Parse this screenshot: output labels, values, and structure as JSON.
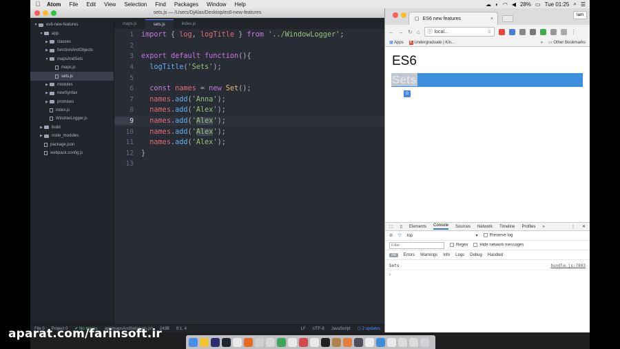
{
  "menubar": {
    "app": "Atom",
    "items": [
      "File",
      "Edit",
      "View",
      "Selection",
      "Find",
      "Packages",
      "Window",
      "Help"
    ],
    "battery": "28%",
    "clock": "Tue 01:25"
  },
  "atom": {
    "window_title": "sets.js — /Users/DjAlas/Desktop/es6-new-features",
    "tree": [
      {
        "label": "es6-new-features",
        "depth": 0,
        "type": "folder",
        "open": true
      },
      {
        "label": "app",
        "depth": 1,
        "type": "folder",
        "open": true
      },
      {
        "label": "classes",
        "depth": 2,
        "type": "folder",
        "open": false
      },
      {
        "label": "functionAndObjects",
        "depth": 2,
        "type": "folder",
        "open": false
      },
      {
        "label": "mapsAndSets",
        "depth": 2,
        "type": "folder",
        "open": true
      },
      {
        "label": "maps.js",
        "depth": 3,
        "type": "file"
      },
      {
        "label": "sets.js",
        "depth": 3,
        "type": "file",
        "selected": true
      },
      {
        "label": "modules",
        "depth": 2,
        "type": "folder",
        "open": false
      },
      {
        "label": "newSyntax",
        "depth": 2,
        "type": "folder",
        "open": false
      },
      {
        "label": "promises",
        "depth": 2,
        "type": "folder",
        "open": false
      },
      {
        "label": "index.js",
        "depth": 2,
        "type": "file"
      },
      {
        "label": "WindowLogger.js",
        "depth": 2,
        "type": "file"
      },
      {
        "label": "build",
        "depth": 1,
        "type": "folder",
        "open": false
      },
      {
        "label": "node_modules",
        "depth": 1,
        "type": "folder",
        "open": false
      },
      {
        "label": "package.json",
        "depth": 1,
        "type": "file"
      },
      {
        "label": "webpack.config.js",
        "depth": 1,
        "type": "file"
      }
    ],
    "tabs": [
      {
        "label": "maps.js",
        "active": false
      },
      {
        "label": "sets.js",
        "active": true
      },
      {
        "label": "index.js",
        "active": false
      }
    ],
    "line_numbers": [
      "1",
      "2",
      "3",
      "4",
      "5",
      "6",
      "7",
      "8",
      "9",
      "10",
      "11",
      "12",
      "13"
    ],
    "status": {
      "file": "File 0",
      "project": "Project 0",
      "issues": "No Issues",
      "path": "app/mapsAndSets/sets.js*",
      "size": "243B",
      "cursor": "9:1, 4",
      "line_ending": "LF",
      "encoding": "UTF-8",
      "grammar": "JavaScript",
      "updates": "2 updates"
    }
  },
  "chrome": {
    "tab_title": "ES6 new features",
    "tab_close": "×",
    "user_button": "Iam",
    "address": "local...",
    "bookmarks": {
      "apps": "Apps",
      "item": "Undergraduate | Kin...",
      "other": "Other Bookmarks",
      "more": "»"
    },
    "page": {
      "h1": "ES6",
      "h2": "Sets"
    },
    "devtools": {
      "tabs": [
        "Elements",
        "Console",
        "Sources",
        "Network",
        "Timeline",
        "Profiles"
      ],
      "active_tab": "Console",
      "more": "»",
      "context": "top",
      "preserve_log": "Preserve log",
      "filter_placeholder": "Filter",
      "regex": "Regex",
      "hide_network": "Hide network messages",
      "levels": [
        "All",
        "Errors",
        "Warnings",
        "Info",
        "Logs",
        "Debug",
        "Handled"
      ],
      "log_message": "Sets",
      "log_source": "bundle.js:7803",
      "prompt": "›"
    }
  },
  "watermark": "aparat.com/farinsoft.ir"
}
